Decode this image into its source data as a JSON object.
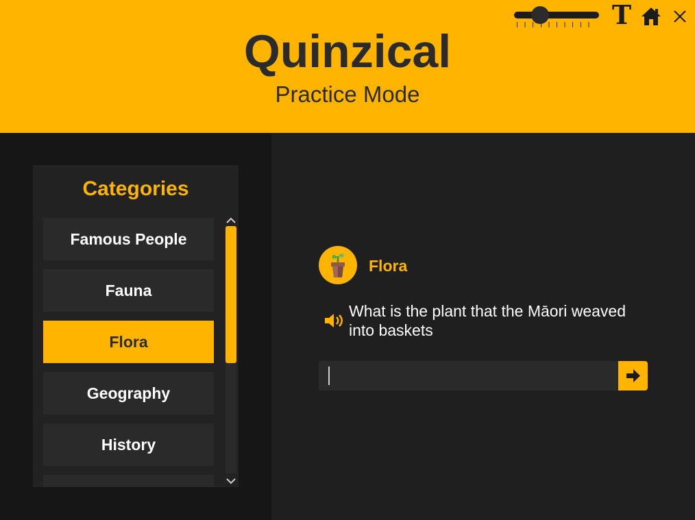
{
  "header": {
    "title": "Quinzical",
    "subtitle": "Practice Mode",
    "text_size_icon": "T",
    "icons": [
      "slider",
      "text-size-icon",
      "home-icon",
      "close-icon"
    ],
    "text_size_slider_level": 0.25
  },
  "sidebar": {
    "heading": "Categories",
    "items": [
      {
        "label": "Famous People",
        "selected": false
      },
      {
        "label": "Fauna",
        "selected": false
      },
      {
        "label": "Flora",
        "selected": true
      },
      {
        "label": "Geography",
        "selected": false
      },
      {
        "label": "History",
        "selected": false
      },
      {
        "label": "",
        "selected": false
      }
    ]
  },
  "question": {
    "category": "Flora",
    "category_icon": "plant-pot-icon",
    "text": "What is the plant that the Māori weaved into baskets",
    "answer_value": "",
    "speaker_icon": "speaker-icon",
    "submit_icon": "arrow-right-icon"
  },
  "colors": {
    "accent": "#ffb400",
    "header_text": "#2b2b2b",
    "panel_bg": "#222222",
    "item_bg": "#2a2a2a",
    "main_bg": "#1f1f1f",
    "sidebar_bg": "#161616"
  }
}
